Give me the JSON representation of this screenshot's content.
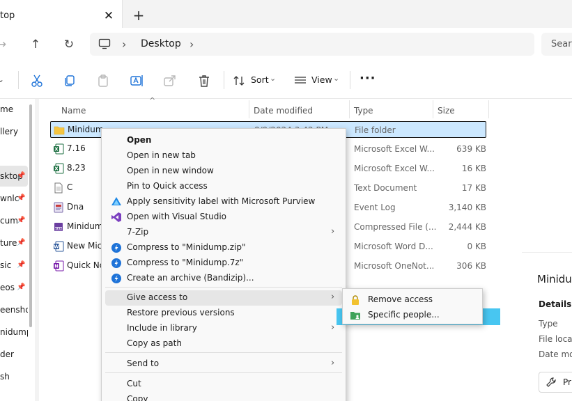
{
  "tab": {
    "title": "top",
    "close": "✕",
    "new": "+"
  },
  "nav": {
    "back": "→",
    "up": "↑",
    "refresh": "↻"
  },
  "address": {
    "chevron1": "›",
    "crumb": "Desktop",
    "chevron2": "›",
    "search_placeholder": "Searc"
  },
  "toolbar": {
    "sort_label": "Sort",
    "view_label": "View",
    "more": "···",
    "dropdown": "⌄"
  },
  "sidebar": {
    "items": [
      {
        "label": "me",
        "pinned": false
      },
      {
        "label": "llery",
        "pinned": false
      },
      {
        "label": "sktop",
        "pinned": true
      },
      {
        "label": "wnlc",
        "pinned": true
      },
      {
        "label": "cum",
        "pinned": true
      },
      {
        "label": "ture",
        "pinned": true
      },
      {
        "label": "sic",
        "pinned": true
      },
      {
        "label": "eos",
        "pinned": true
      },
      {
        "label": "eensho",
        "pinned": false
      },
      {
        "label": "nidump",
        "pinned": false
      },
      {
        "label": "der",
        "pinned": false
      },
      {
        "label": "sh",
        "pinned": false
      }
    ],
    "pin_glyph": "📌"
  },
  "columns": {
    "name": "Name",
    "date": "Date modified",
    "type": "Type",
    "size": "Size",
    "sort_caret": "^"
  },
  "files": [
    {
      "name": "Minidum",
      "date": "8/9/2024 3:42 PM",
      "type": "File folder",
      "size": "",
      "icon": "folder-icon"
    },
    {
      "name": "7.16",
      "date": "",
      "type": "Microsoft Excel W...",
      "size": "639 KB",
      "icon": "excel-icon"
    },
    {
      "name": "8.23",
      "date": "",
      "type": "Microsoft Excel W...",
      "size": "16 KB",
      "icon": "excel-icon"
    },
    {
      "name": "C",
      "date": "",
      "type": "Text Document",
      "size": "17 KB",
      "icon": "text-file-icon"
    },
    {
      "name": "Dna",
      "date": "",
      "type": "Event Log",
      "size": "3,140 KB",
      "icon": "event-log-icon"
    },
    {
      "name": "Minidum",
      "date": "",
      "type": "Compressed File (...",
      "size": "2,444 KB",
      "icon": "archive-icon"
    },
    {
      "name": "New Micr",
      "date": "",
      "type": "Microsoft Word D...",
      "size": "0 KB",
      "icon": "word-icon"
    },
    {
      "name": "Quick No",
      "date": "",
      "type": "Microsoft OneNot...",
      "size": "306 KB",
      "icon": "onenote-icon"
    }
  ],
  "context_menu": {
    "items": [
      {
        "label": "Open",
        "bold": true,
        "icon": "",
        "submenu": false
      },
      {
        "label": "Open in new tab",
        "icon": "",
        "submenu": false
      },
      {
        "label": "Open in new window",
        "icon": "",
        "submenu": false
      },
      {
        "label": "Pin to Quick access",
        "icon": "",
        "submenu": false
      },
      {
        "label": "Apply sensitivity label with Microsoft Purview",
        "icon": "purview-icon",
        "submenu": false
      },
      {
        "label": "Open with Visual Studio",
        "icon": "visual-studio-icon",
        "submenu": false
      },
      {
        "label": "7-Zip",
        "icon": "",
        "submenu": true
      },
      {
        "label": "Compress to \"Minidump.zip\"",
        "icon": "bandizip-icon",
        "submenu": false
      },
      {
        "label": "Compress to \"Minidump.7z\"",
        "icon": "bandizip-icon",
        "submenu": false
      },
      {
        "label": "Create an archive (Bandizip)...",
        "icon": "bandizip-icon",
        "submenu": false
      },
      {
        "label": "Give access to",
        "icon": "",
        "submenu": true,
        "hover": true
      },
      {
        "label": "Restore previous versions",
        "icon": "",
        "submenu": false
      },
      {
        "label": "Include in library",
        "icon": "",
        "submenu": true
      },
      {
        "label": "Copy as path",
        "icon": "",
        "submenu": false
      },
      {
        "label": "Send to",
        "icon": "",
        "submenu": true
      },
      {
        "label": "Cut",
        "icon": "",
        "submenu": false
      },
      {
        "label": "Copy",
        "icon": "",
        "submenu": false
      }
    ],
    "arrow": "›"
  },
  "submenu": {
    "items": [
      {
        "label": "Remove access",
        "icon": "lock-icon"
      },
      {
        "label": "Specific people...",
        "icon": "people-icon",
        "highlighted": true
      }
    ]
  },
  "details": {
    "title": "Minidun",
    "section": "Details",
    "labels": [
      "Type",
      "File locat",
      "Date mod"
    ],
    "button_label": "Pr"
  },
  "colors": {
    "selection": "#cce8ff",
    "highlight": "#48c6f1",
    "folder": "#f5c542",
    "excel": "#1d6f42",
    "word": "#2b579a",
    "onenote": "#7719aa",
    "bandizip": "#1e73d8",
    "vs": "#7b3fbf"
  }
}
